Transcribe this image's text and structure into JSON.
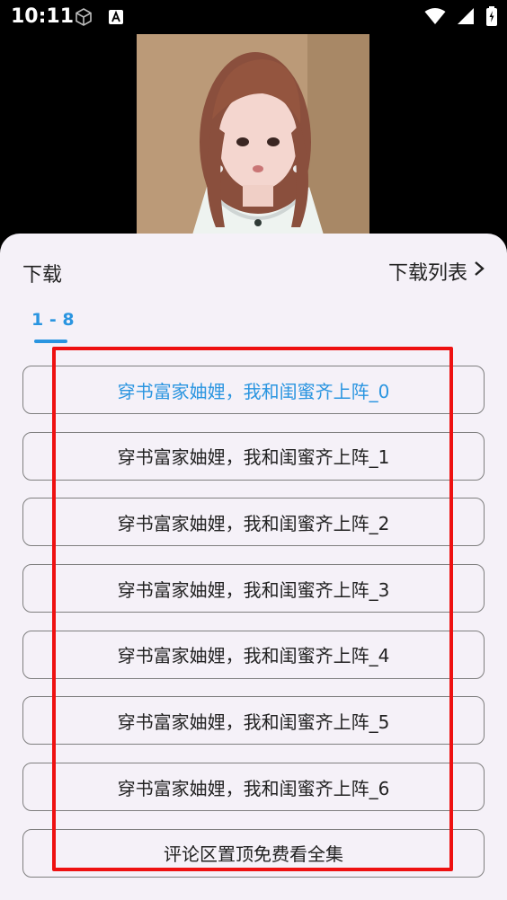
{
  "status": {
    "time": "10:11"
  },
  "sheet": {
    "title": "下载",
    "list_link": "下载列表",
    "tab_range": "1 - 8"
  },
  "episodes": [
    {
      "label": "穿书富家妯娌，我和闺蜜齐上阵_0",
      "selected": true
    },
    {
      "label": "穿书富家妯娌，我和闺蜜齐上阵_1",
      "selected": false
    },
    {
      "label": "穿书富家妯娌，我和闺蜜齐上阵_2",
      "selected": false
    },
    {
      "label": "穿书富家妯娌，我和闺蜜齐上阵_3",
      "selected": false
    },
    {
      "label": "穿书富家妯娌，我和闺蜜齐上阵_4",
      "selected": false
    },
    {
      "label": "穿书富家妯娌，我和闺蜜齐上阵_5",
      "selected": false
    },
    {
      "label": "穿书富家妯娌，我和闺蜜齐上阵_6",
      "selected": false
    }
  ],
  "promo_button": "评论区置顶免费看全集",
  "colors": {
    "accent": "#2a95e0",
    "highlight": "#ee1111",
    "sheet_bg": "#f5f1f8"
  },
  "icons": [
    "cube-icon",
    "font-a-icon",
    "wifi-icon",
    "signal-icon",
    "battery-icon",
    "chevron-right-icon"
  ]
}
